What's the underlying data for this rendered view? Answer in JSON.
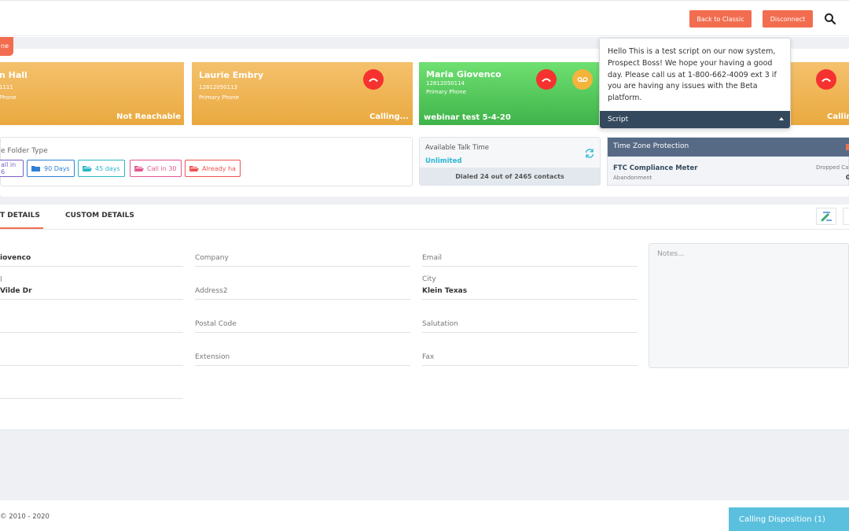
{
  "header": {
    "back_to_classic": "Back to Classic",
    "disconnect": "Disconnect",
    "search_icon": "search-icon"
  },
  "left_tab_label": "ne",
  "cards": [
    {
      "name": "n Hall",
      "number": "1111",
      "phone_label": "Phone",
      "status": "Not Reachable"
    },
    {
      "name": "Laurie Embry",
      "number": "12812050113",
      "phone_label": "Primary Phone",
      "status": "Calling..."
    },
    {
      "name": "Maria Giovenco",
      "number": "12812050114",
      "phone_label": "Primary Phone",
      "status": "webinar test 5-4-20"
    },
    {
      "status": "Callin"
    }
  ],
  "script": {
    "text": "Hello This is a test script on our now system, Prospect Boss! We hope your having a good day. Please call us at 1-800-662-4009 ext 3 if you are having any issues with the Beta platform.",
    "label": "Script"
  },
  "folder": {
    "title": "e Folder Type",
    "chips": [
      {
        "label": "all in 6",
        "color": "#7b5fc6"
      },
      {
        "label": "90 Days",
        "color": "#2f80d6"
      },
      {
        "label": "45 days",
        "color": "#29b6c8"
      },
      {
        "label": "Call in 30",
        "color": "#e2578f"
      },
      {
        "label": "Already ha",
        "color": "#ef5350"
      }
    ]
  },
  "talk_time": {
    "label": "Available Talk Time",
    "value": "Unlimited",
    "dialed": "Dialed 24 out of 2465 contacts"
  },
  "timezone": {
    "header": "Time Zone Protection",
    "meter": "FTC Compliance Meter",
    "meter_sub": "Abandonment",
    "dropped_label": "Dropped Cal",
    "dropped_value": "0"
  },
  "tabs": {
    "active": "T DETAILS",
    "custom": "CUSTOM DETAILS"
  },
  "fields": {
    "col1": [
      {
        "label": "",
        "value": "iovenco"
      },
      {
        "label": "l",
        "value": "Vilde Dr"
      },
      {
        "label": "",
        "value": ""
      },
      {
        "label": "",
        "value": ""
      },
      {
        "label": "",
        "value": ""
      }
    ],
    "company": "Company",
    "address2": "Address2",
    "postal_code": "Postal Code",
    "extension": "Extension",
    "email": "Email",
    "city_label": "City",
    "city_value": "Klein Texas",
    "salutation": "Salutation",
    "fax": "Fax"
  },
  "notes_placeholder": "Notes...",
  "footer": {
    "copyright": "© 2010 - 2020",
    "disposition": "Calling Disposition (1)"
  }
}
